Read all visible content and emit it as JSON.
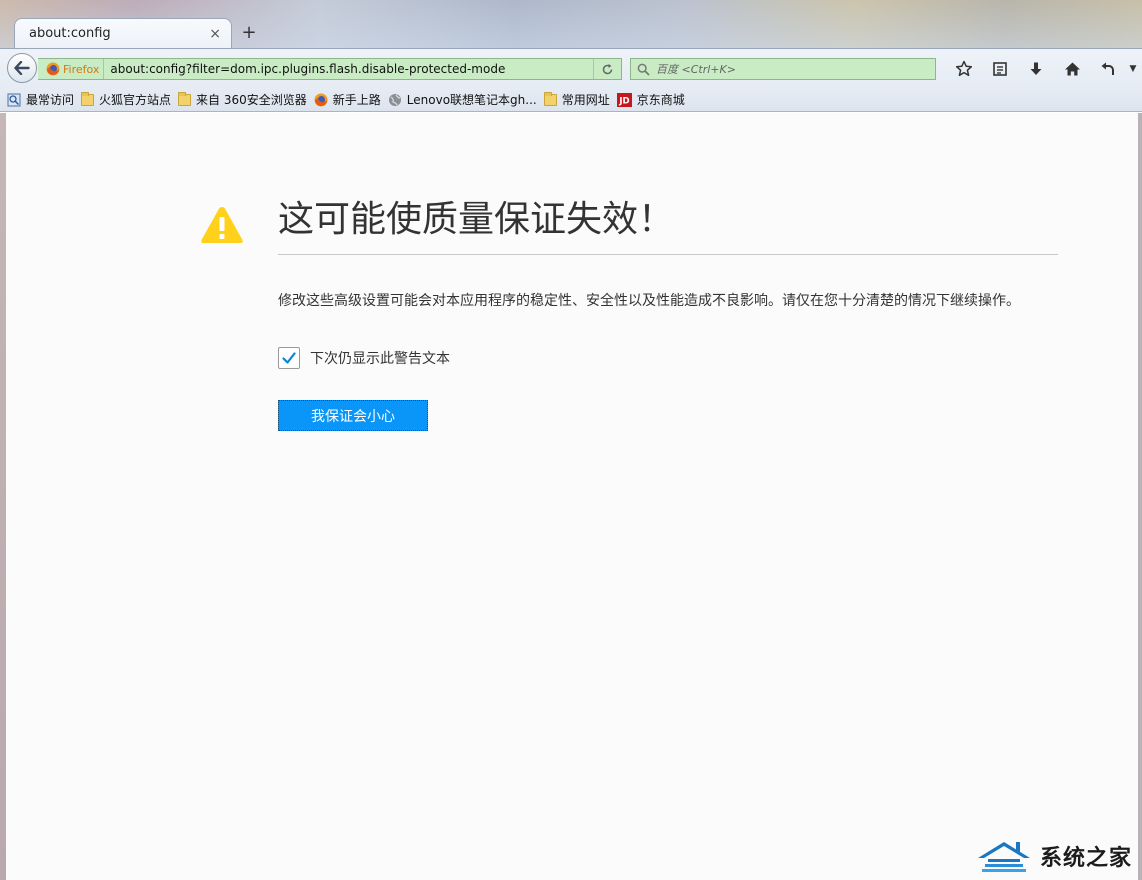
{
  "tab": {
    "title": "about:config",
    "close_glyph": "×",
    "new_tab_glyph": "+"
  },
  "navbar": {
    "identity_label": "Firefox",
    "url": "about:config?filter=dom.ipc.plugins.flash.disable-protected-mode",
    "search_placeholder": "百度 <Ctrl+K>",
    "icons": [
      "back-arrow-icon",
      "firefox-logo-icon",
      "reload-icon",
      "search-icon",
      "bookmark-star-icon",
      "reading-list-icon",
      "download-icon",
      "home-icon",
      "undo-icon",
      "menu-dropdown-icon"
    ]
  },
  "bookmarks": {
    "items": [
      {
        "label": "最常访问",
        "icon": "most-visited-icon"
      },
      {
        "label": "火狐官方站点",
        "icon": "folder-icon"
      },
      {
        "label": "来自 360安全浏览器",
        "icon": "folder-icon"
      },
      {
        "label": "新手上路",
        "icon": "firefox-logo-icon"
      },
      {
        "label": "Lenovo联想笔记本gh...",
        "icon": "globe-icon"
      },
      {
        "label": "常用网址",
        "icon": "folder-icon"
      },
      {
        "label": "京东商城",
        "icon": "jd-logo-icon"
      }
    ]
  },
  "warning": {
    "title": "这可能使质量保证失效！",
    "description": "修改这些高级设置可能会对本应用程序的稳定性、安全性以及性能造成不良影响。请仅在您十分清楚的情况下继续操作。",
    "checkbox_label": "下次仍显示此警告文本",
    "checkbox_checked": true,
    "button_label": "我保证会小心"
  },
  "watermark": {
    "text": "系统之家"
  },
  "colors": {
    "url_bar_bg": "#c9ecc5",
    "button_bg": "#0996f8",
    "warning_yellow": "#ffd11a",
    "firefox_orange": "#d4770f"
  }
}
